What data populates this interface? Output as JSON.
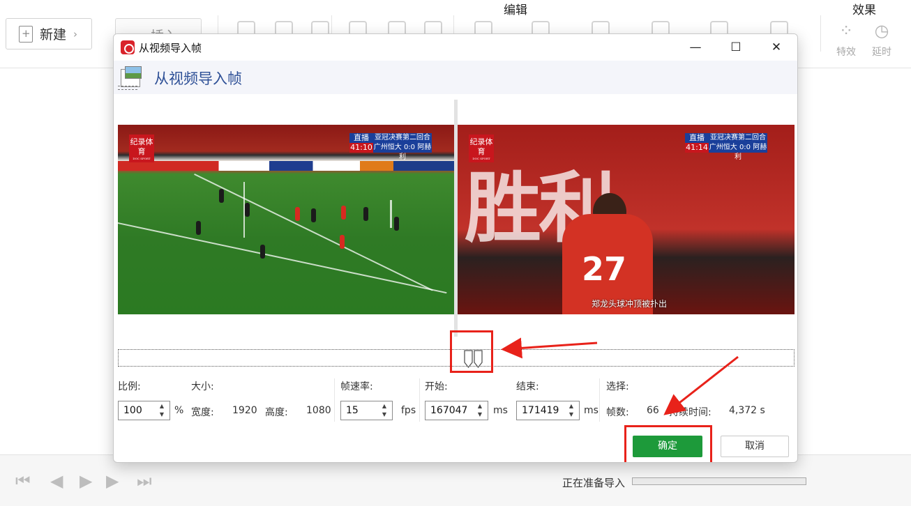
{
  "app": {
    "new_label": "新建",
    "insert_label": "插入",
    "group_edit": "编辑",
    "group_effects": "效果",
    "effects_items": [
      {
        "label": "特效",
        "icon": "four-circles-icon"
      },
      {
        "label": "延时",
        "icon": "stopwatch-icon"
      }
    ]
  },
  "bottom": {
    "status": "正在准备导入",
    "progress": 0
  },
  "dialog": {
    "title": "从视频导入帧",
    "header": "从视频导入帧",
    "frames": {
      "channel_badge": "纪录体育",
      "channel_sub": "DOC SPORT",
      "left": {
        "live": "直播",
        "match": "亚冠决赛第二回合",
        "clock": "41:10",
        "score": "广州恒大 0:0 阿赫利"
      },
      "right": {
        "live": "直播",
        "match": "亚冠决赛第二回合",
        "clock": "41:14",
        "score": "广州恒大 0:0 阿赫利",
        "subtitle": "郑龙头球冲顶被扑出",
        "shirt_number": "27",
        "banner_text": "胜利"
      }
    },
    "params": {
      "scale_label": "比例:",
      "scale_value": "100",
      "scale_unit": "%",
      "size_label": "大小:",
      "width_label": "宽度:",
      "width_value": "1920",
      "height_label": "高度:",
      "height_value": "1080",
      "fps_label": "帧速率:",
      "fps_value": "15",
      "fps_unit": "fps",
      "start_label": "开始:",
      "start_value": "167047",
      "start_unit": "ms",
      "end_label": "结束:",
      "end_value": "171419",
      "end_unit": "ms",
      "selection_label": "选择:",
      "frames_label": "帧数:",
      "frames_value": "66",
      "duration_label": "持续时间:",
      "duration_value": "4,372 s"
    },
    "ok_label": "确定",
    "cancel_label": "取消"
  },
  "colors": {
    "ok_green": "#1d9a3a",
    "header_blue": "#2d4f96",
    "annotation_red": "#e8221a",
    "logo_red": "#d9232b"
  }
}
